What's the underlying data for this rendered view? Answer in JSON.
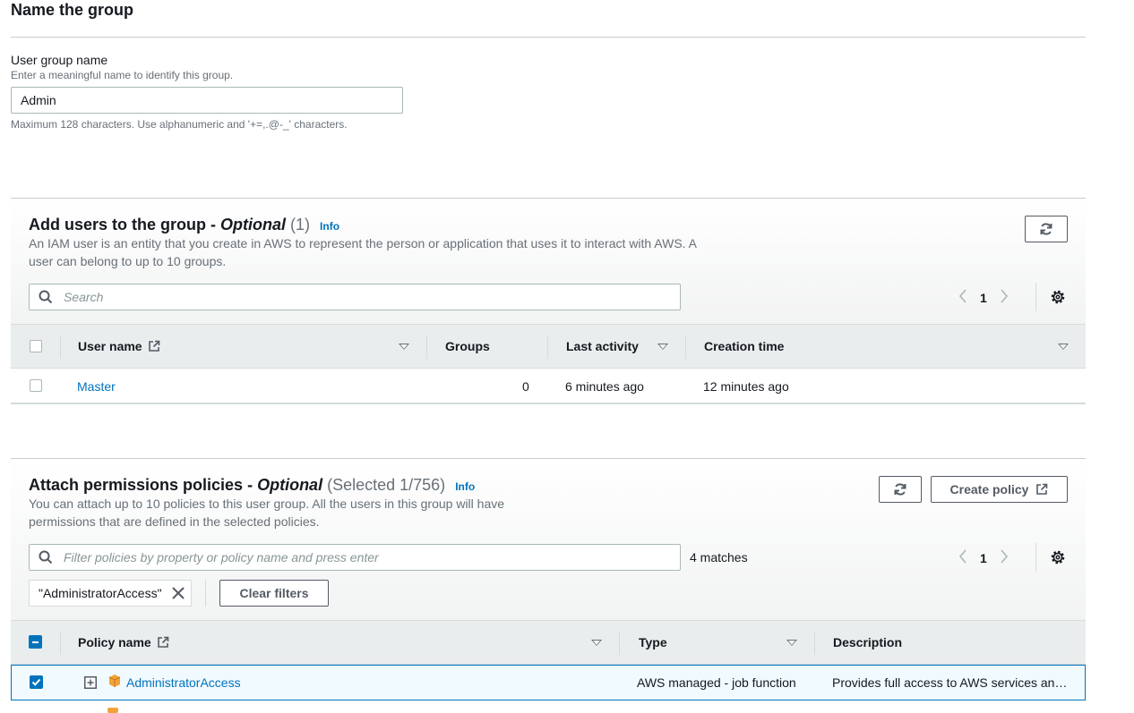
{
  "page_title": "Name the group",
  "group_name": {
    "label": "User group name",
    "description": "Enter a meaningful name to identify this group.",
    "value": "Admin",
    "constraint": "Maximum 128 characters. Use alphanumeric and '+=,.@-_' characters."
  },
  "users_section": {
    "title": "Add users to the group - ",
    "optional": "Optional",
    "count": "(1)",
    "info": "Info",
    "description_line1": "An IAM user is an entity that you create in AWS to represent the person or application that uses it to interact with AWS. A",
    "description_line2": "user can belong to up to 10 groups.",
    "search_placeholder": "Search",
    "page": "1",
    "columns": [
      "User name",
      "Groups",
      "Last activity",
      "Creation time"
    ],
    "rows": [
      {
        "user_name": "Master",
        "groups": "0",
        "last_activity": "6 minutes ago",
        "creation_time": "12 minutes ago"
      }
    ]
  },
  "policies_section": {
    "title": "Attach permissions policies - ",
    "optional": "Optional",
    "count": "(Selected 1/756)",
    "info": "Info",
    "description_line1": "You can attach up to 10 policies to this user group. All the users in this group will have",
    "description_line2": "permissions that are defined in the selected policies.",
    "create_policy_label": "Create policy",
    "filter_placeholder": "Filter policies by property or policy name and press enter",
    "matches": "4 matches",
    "page": "1",
    "filter_token": "\"AdministratorAccess\"",
    "clear_filters_label": "Clear filters",
    "columns": [
      "Policy name",
      "Type",
      "Description"
    ],
    "rows": [
      {
        "policy_name": "AdministratorAccess",
        "type": "AWS managed - job function",
        "description": "Provides full access to AWS services an…",
        "selected": true
      }
    ]
  },
  "colors": {
    "link": "#0073bb",
    "selection": "#0073bb",
    "policy_icon": "#f3a33a"
  },
  "icons": [
    "refresh-icon",
    "search-icon",
    "gear-icon",
    "external-link-icon",
    "close-icon",
    "expand-plus-icon",
    "aws-policy-cube-icon",
    "chevron-left-icon",
    "chevron-right-icon",
    "sort-caret-icon"
  ]
}
